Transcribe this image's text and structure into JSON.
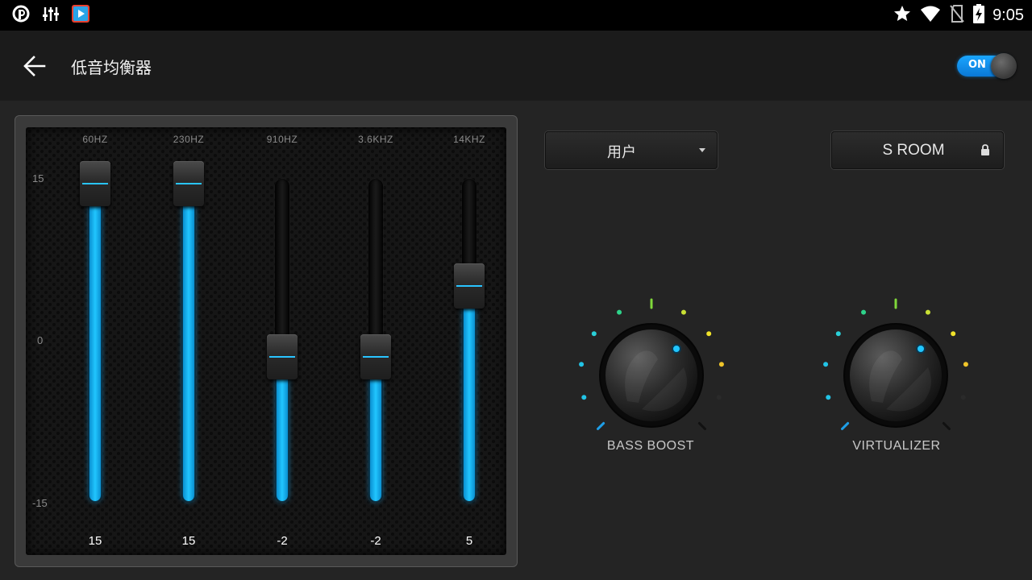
{
  "status_bar": {
    "time": "9:05",
    "left_icons": [
      "notification-app-icon",
      "equalizer-notification-icon",
      "video-app-icon"
    ],
    "right_icons": [
      "star-icon",
      "wifi-icon",
      "no-sim-icon",
      "battery-charging-icon"
    ]
  },
  "app_bar": {
    "title": "低音均衡器",
    "toggle_label": "ON",
    "toggle_on": true
  },
  "equalizer": {
    "db_labels": {
      "max": "15",
      "mid": "0",
      "min": "-15"
    },
    "range": [
      -15,
      15
    ],
    "bands": [
      {
        "freq": "60HZ",
        "value": 15,
        "value_label": "15"
      },
      {
        "freq": "230HZ",
        "value": 15,
        "value_label": "15"
      },
      {
        "freq": "910HZ",
        "value": -2,
        "value_label": "-2"
      },
      {
        "freq": "3.6KHZ",
        "value": -2,
        "value_label": "-2"
      },
      {
        "freq": "14KHZ",
        "value": 5,
        "value_label": "5"
      }
    ]
  },
  "preset": {
    "label": "用户"
  },
  "reverb": {
    "label": "S ROOM",
    "locked": true
  },
  "knobs": {
    "bass_boost": {
      "label": "BASS BOOST"
    },
    "virtualizer": {
      "label": "VIRTUALIZER"
    }
  },
  "colors": {
    "accent": "#21c6ff",
    "toggle_on": "#1aa6ff",
    "background": "#242424"
  }
}
